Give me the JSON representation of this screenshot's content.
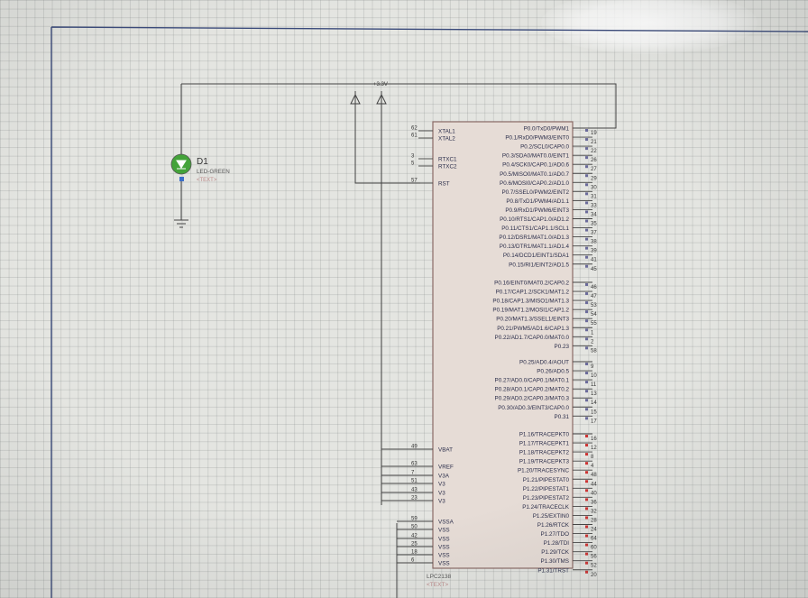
{
  "schematic": {
    "frame_color": "#3a4a7a",
    "wire_color": "#444444",
    "chip_fill": "#e6dcd6",
    "chip_border": "#8a6a66",
    "supply_label": "+3.3V",
    "led": {
      "ref": "D1",
      "value": "LED-GREEN",
      "text": "<TEXT>",
      "color": "#44a33a"
    },
    "chip": {
      "part": "LPC2138",
      "text": "<TEXT>",
      "left_pins": [
        {
          "num": "62",
          "label": "XTAL1"
        },
        {
          "num": "61",
          "label": "XTAL2"
        },
        {
          "num": "3",
          "label": "RTXC1"
        },
        {
          "num": "5",
          "label": "RTXC2"
        },
        {
          "num": "57",
          "label": "RST"
        },
        {
          "num": "49",
          "label": "VBAT"
        },
        {
          "num": "63",
          "label": "VREF"
        },
        {
          "num": "7",
          "label": "V3A"
        },
        {
          "num": "51",
          "label": "V3"
        },
        {
          "num": "43",
          "label": "V3"
        },
        {
          "num": "23",
          "label": "V3"
        },
        {
          "num": "59",
          "label": "VSSA"
        },
        {
          "num": "50",
          "label": "VSS"
        },
        {
          "num": "42",
          "label": "VSS"
        },
        {
          "num": "25",
          "label": "VSS"
        },
        {
          "num": "18",
          "label": "VSS"
        },
        {
          "num": "6",
          "label": "VSS"
        }
      ],
      "right_pins": [
        {
          "num": "19",
          "label": "P0.0/TxD0/PWM1"
        },
        {
          "num": "21",
          "label": "P0.1/RxD0/PWM3/EINT0"
        },
        {
          "num": "22",
          "label": "P0.2/SCL0/CAP0.0"
        },
        {
          "num": "26",
          "label": "P0.3/SDA0/MAT0.0/EINT1"
        },
        {
          "num": "27",
          "label": "P0.4/SCK0/CAP0.1/AD0.6"
        },
        {
          "num": "29",
          "label": "P0.5/MISO0/MAT0.1/AD0.7"
        },
        {
          "num": "30",
          "label": "P0.6/MOSI0/CAP0.2/AD1.0"
        },
        {
          "num": "31",
          "label": "P0.7/SSEL0/PWM2/EINT2"
        },
        {
          "num": "33",
          "label": "P0.8/TxD1/PWM4/AD1.1"
        },
        {
          "num": "34",
          "label": "P0.9/RxD1/PWM6/EINT3"
        },
        {
          "num": "35",
          "label": "P0.10/RTS1/CAP1.0/AD1.2"
        },
        {
          "num": "37",
          "label": "P0.11/CTS1/CAP1.1/SCL1"
        },
        {
          "num": "38",
          "label": "P0.12/DSR1/MAT1.0/AD1.3"
        },
        {
          "num": "39",
          "label": "P0.13/DTR1/MAT1.1/AD1.4"
        },
        {
          "num": "41",
          "label": "P0.14/DCD1/EINT1/SDA1"
        },
        {
          "num": "45",
          "label": "P0.15/RI1/EINT2/AD1.5"
        },
        {
          "num": "46",
          "label": "P0.16/EINT0/MAT0.2/CAP0.2"
        },
        {
          "num": "47",
          "label": "P0.17/CAP1.2/SCK1/MAT1.2"
        },
        {
          "num": "53",
          "label": "P0.18/CAP1.3/MISO1/MAT1.3"
        },
        {
          "num": "54",
          "label": "P0.19/MAT1.2/MOSI1/CAP1.2"
        },
        {
          "num": "55",
          "label": "P0.20/MAT1.3/SSEL1/EINT3"
        },
        {
          "num": "1",
          "label": "P0.21/PWM5/AD1.6/CAP1.3"
        },
        {
          "num": "2",
          "label": "P0.22/AD1.7/CAP0.0/MAT0.0"
        },
        {
          "num": "58",
          "label": "P0.23"
        },
        {
          "num": "9",
          "label": "P0.25/AD0.4/AOUT"
        },
        {
          "num": "10",
          "label": "P0.26/AD0.5"
        },
        {
          "num": "11",
          "label": "P0.27/AD0.0/CAP0.1/MAT0.1"
        },
        {
          "num": "13",
          "label": "P0.28/AD0.1/CAP0.2/MAT0.2"
        },
        {
          "num": "14",
          "label": "P0.29/AD0.2/CAP0.3/MAT0.3"
        },
        {
          "num": "15",
          "label": "P0.30/AD0.3/EINT3/CAP0.0"
        },
        {
          "num": "17",
          "label": "P0.31"
        },
        {
          "num": "16",
          "label": "P1.16/TRACEPKT0"
        },
        {
          "num": "12",
          "label": "P1.17/TRACEPKT1"
        },
        {
          "num": "8",
          "label": "P1.18/TRACEPKT2"
        },
        {
          "num": "4",
          "label": "P1.19/TRACEPKT3"
        },
        {
          "num": "48",
          "label": "P1.20/TRACESYNC"
        },
        {
          "num": "44",
          "label": "P1.21/PIPESTAT0"
        },
        {
          "num": "40",
          "label": "P1.22/PIPESTAT1"
        },
        {
          "num": "36",
          "label": "P1.23/PIPESTAT2"
        },
        {
          "num": "32",
          "label": "P1.24/TRACECLK"
        },
        {
          "num": "28",
          "label": "P1.25/EXTIN0"
        },
        {
          "num": "24",
          "label": "P1.26/RTCK"
        },
        {
          "num": "64",
          "label": "P1.27/TDO"
        },
        {
          "num": "60",
          "label": "P1.28/TDI"
        },
        {
          "num": "56",
          "label": "P1.29/TCK"
        },
        {
          "num": "52",
          "label": "P1.30/TMS"
        },
        {
          "num": "20",
          "label": "P1.31/TRST"
        }
      ]
    }
  }
}
